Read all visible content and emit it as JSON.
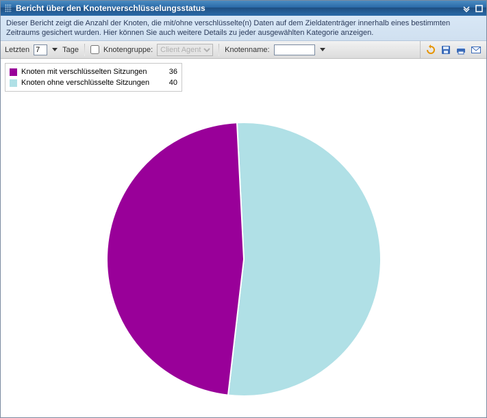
{
  "titlebar": {
    "title": "Bericht über den Knotenverschlüsselungsstatus"
  },
  "description": "Dieser Bericht zeigt die Anzahl der Knoten, die mit/ohne verschlüsselte(n) Daten auf dem Zieldatenträger innerhalb eines bestimmten Zeitraums gesichert wurden. Hier können Sie auch weitere Details zu jeder ausgewählten Kategorie anzeigen.",
  "toolbar": {
    "last_label": "Letzten",
    "days_value": "7",
    "days_label": "Tage",
    "nodegroup_label": "Knotengruppe:",
    "nodegroup_selected": "Client Agent",
    "nodename_label": "Knotenname:",
    "nodename_value": ""
  },
  "legend": {
    "items": [
      {
        "label": "Knoten mit verschlüsselten Sitzungen",
        "value": "36",
        "color": "#990099"
      },
      {
        "label": "Knoten ohne verschlüsselte Sitzungen",
        "value": "40",
        "color": "#b0e0e6"
      }
    ]
  },
  "chart_data": {
    "type": "pie",
    "title": "Bericht über den Knotenverschlüsselungsstatus",
    "series": [
      {
        "name": "Knoten mit verschlüsselten Sitzungen",
        "value": 36,
        "color": "#990099"
      },
      {
        "name": "Knoten ohne verschlüsselte Sitzungen",
        "value": 40,
        "color": "#b0e0e6"
      }
    ]
  },
  "colors": {
    "encrypted": "#990099",
    "unencrypted": "#b0e0e6"
  }
}
